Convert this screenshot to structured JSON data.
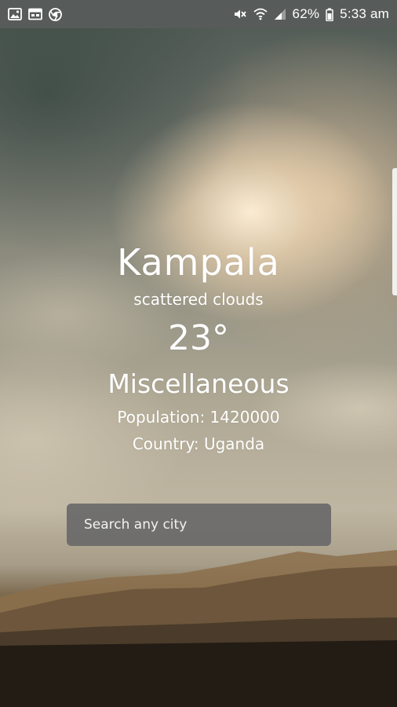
{
  "status_bar": {
    "left_icons": [
      "image-icon",
      "calendar-icon",
      "chrome-icon"
    ],
    "right_icons": [
      "mute-icon",
      "wifi-icon",
      "signal-icon",
      "battery-icon"
    ],
    "battery_percent": "62%",
    "time": "5:33 am"
  },
  "weather": {
    "city": "Kampala",
    "condition": "scattered clouds",
    "temperature": "23°",
    "category": "Miscellaneous",
    "population": "Population: 1420000",
    "country": "Country: Uganda"
  },
  "search": {
    "placeholder": "Search any city",
    "value": ""
  }
}
